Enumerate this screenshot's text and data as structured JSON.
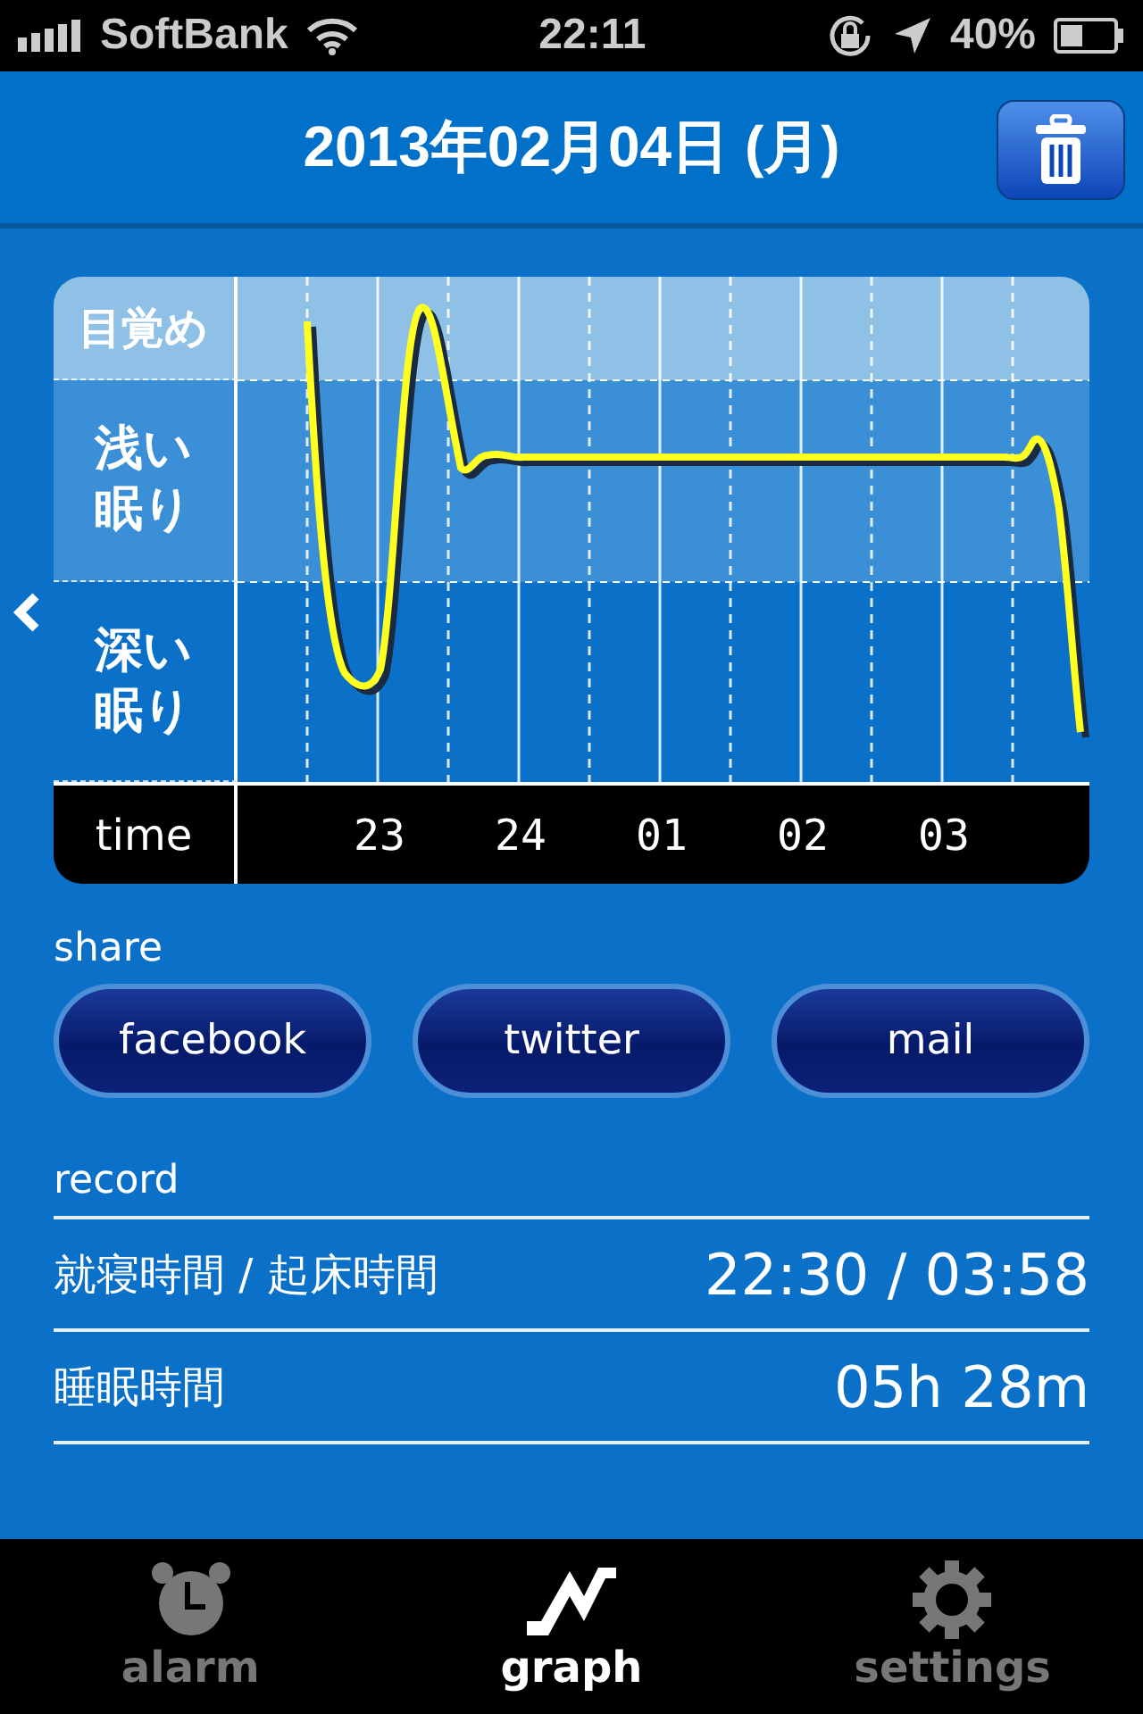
{
  "status_bar": {
    "carrier": "SoftBank",
    "time": "22:11",
    "battery": "40%"
  },
  "header": {
    "title": "2013年02月04日 (月)"
  },
  "graph": {
    "bands": [
      {
        "label": "目覚め",
        "kind": "wake"
      },
      {
        "label": "浅い眠り",
        "kind": "light"
      },
      {
        "label": "深い眠り",
        "kind": "deep"
      }
    ],
    "time_label": "time",
    "hours": [
      "23",
      "24",
      "01",
      "02",
      "03"
    ]
  },
  "share": {
    "label": "share",
    "buttons": [
      "facebook",
      "twitter",
      "mail"
    ]
  },
  "record": {
    "label": "record",
    "rows": [
      {
        "label": "就寝時間 / 起床時間",
        "value": "22:30 / 03:58"
      },
      {
        "label": "睡眠時間",
        "value": "05h 28m"
      }
    ]
  },
  "tabs": [
    {
      "label": "alarm",
      "kind": "alarm",
      "selected": false
    },
    {
      "label": "graph",
      "kind": "graph",
      "selected": true
    },
    {
      "label": "settings",
      "kind": "settings",
      "selected": false
    }
  ]
}
